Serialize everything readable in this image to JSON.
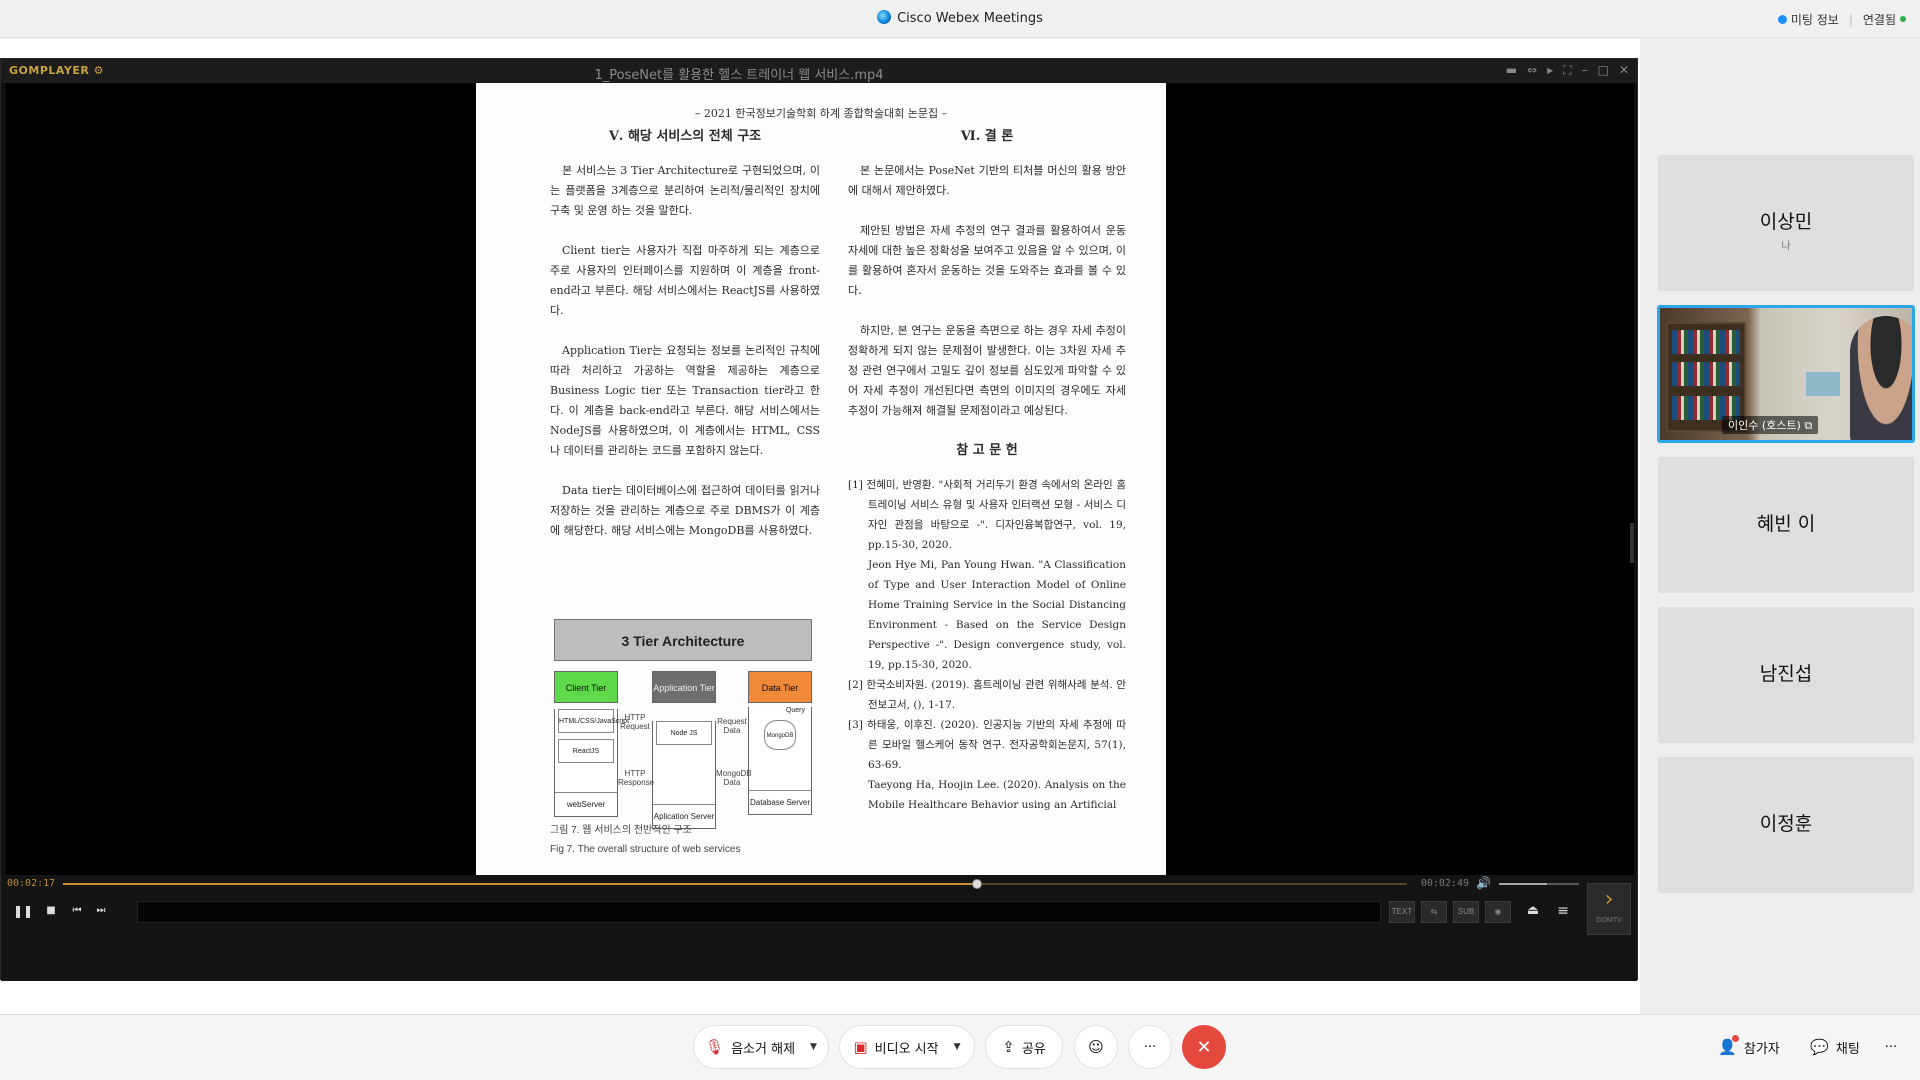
{
  "window": {
    "title": "Cisco Webex Meetings",
    "meeting_info": "미팅 정보",
    "connection": "연결됨"
  },
  "gom": {
    "logo": "GOMPLAYER ⚙",
    "filename": "1_PoseNet를 활용한 헬스 트레이너 웹 서비스.mp4",
    "time_current": "00:02:17",
    "time_total": "00:02:49",
    "progress": 0.68,
    "volume": 0.6,
    "buttons": {
      "tool1": "TEXT",
      "tool2": "⇆",
      "sub": "SUB",
      "cam": "◉",
      "eject": "⏏",
      "menu": "≡"
    },
    "gomtv_label": "GOMTV"
  },
  "document": {
    "header": "– 2021 한국정보기술학회 하계 종합학술대회 논문집 –",
    "left_title": "Ⅴ. 해당 서비스의 전체 구조",
    "left_paras": [
      "본 서비스는 3 Tier Architecture로 구현되었으며, 이는 플랫폼을 3계층으로 분리하여 논리적/물리적인 장치에 구축 및 운영 하는 것을 말한다.",
      "Client tier는 사용자가 직접 마주하게 되는 계층으로 주로 사용자의 인터페이스를 지원하며 이 계층을 front-end라고 부른다. 해당 서비스에서는 ReactJS를 사용하였다.",
      "Application Tier는 요청되는 정보를 논리적인 규칙에 따라 처리하고 가공하는 역할을 제공하는 계층으로 Business Logic tier 또는 Transaction tier라고 한다. 이 계층을 back-end라고 부른다. 해당 서비스에서는 NodeJS를 사용하였으며, 이 계층에서는 HTML, CSS 나 데이터를 관리하는 코드를 포함하지 않는다.",
      "Data tier는 데이터베이스에 접근하여 데이터를 읽거나 저장하는 것을 관리하는 계층으로 주로 DBMS가 이 계층에 해당한다. 해당 서비스에는 MongoDB를 사용하였다."
    ],
    "arch_title": "3 Tier Architecture",
    "tiers": [
      {
        "head": "Client Tier",
        "color": "#5fd94a",
        "items": [
          "HTML/CSS/JavaScript",
          "ReactJS"
        ],
        "foot": "webServer"
      },
      {
        "head": "Application Tier",
        "color": "#6e6e6e",
        "items": [
          "Node JS"
        ],
        "foot": "Aplication Server"
      },
      {
        "head": "Data Tier",
        "color": "#f08a3a",
        "items": [
          "Query",
          "MongoDB"
        ],
        "foot": "Database Server"
      }
    ],
    "flows": {
      "http_request": "HTTP Request",
      "http_response": "HTTP Response",
      "request_data": "Request Data",
      "mongodb_data": "MongoDB Data"
    },
    "fig_caption_ko": "그림 7. 웹 서비스의 전반적인 구조",
    "fig_caption_en": "Fig 7. The overall structure of web services",
    "right_title": "Ⅵ. 결 론",
    "right_paras": [
      "본 논문에서는 PoseNet 기반의 티처블 머신의 활용 방안에 대해서 제안하였다.",
      "제안된 방법은 자세 추정의 연구 결과를 활용하여서 운동 자세에 대한 높은 정확성을 보여주고 있음을 알 수 있으며, 이를 활용하여 혼자서 운동하는 것을 도와주는 효과를 볼 수 있다.",
      "하지만, 본 연구는 운동을 측면으로 하는 경우 자세 추정이 정확하게 되지 않는 문제점이 발생한다. 이는 3차원 자세 추정 관련 연구에서 고밀도 깊이 정보를 심도있게 파악할 수 있어 자세 추정이 개선된다면 측면의 이미지의 경우에도 자세 추정이 가능해져 해결될 문제점이라고 예상된다."
    ],
    "ref_title": "참 고 문 헌",
    "refs": [
      "[1] 전혜미, 반영환. \"사회적 거리두기 환경 속에서의 온라인 홈 트레이닝 서비스 유형 및 사용자 인터랙션 모형 - 서비스 디자인 관점을 바탕으로 -\". 디자인융복합연구, vol. 19, pp.15-30, 2020.",
      "Jeon Hye Mi, Pan Young Hwan. \"A Classification of Type and User Interaction Model of Online Home Training Service in the Social Distancing Environment - Based on the Service Design Perspective -\". Design convergence study, vol. 19, pp.15-30, 2020.",
      "[2] 한국소비자원. (2019). 홈트레이닝 관련 위해사례 분석. 안전보고서, (), 1-17.",
      "[3] 하태웅, 이후진. (2020). 인공지능 기반의 자세 추정에 따른 모바일 헬스케어 동작 연구. 전자공학회논문지, 57(1), 63-69.",
      "Taeyong Ha, Hoojin Lee. (2020). Analysis on the Mobile Healthcare Behavior using an Artificial"
    ]
  },
  "participants": [
    {
      "name": "이상민",
      "sub": "나"
    },
    {
      "name": "이인수 (호스트)",
      "video": true
    },
    {
      "name": "혜빈 이"
    },
    {
      "name": "남진섭"
    },
    {
      "name": "이정훈"
    }
  ],
  "toolbar": {
    "mute": "음소거 해제",
    "video": "비디오 시작",
    "share": "공유",
    "reaction_icon": "smile-icon",
    "more": "···",
    "end_icon": "✕",
    "participants": "참가자",
    "chat": "채팅",
    "more_right": "···"
  },
  "colors": {
    "accent": "#2aa7e8",
    "end": "#e5483c",
    "gom_progress": "#c8902e"
  }
}
